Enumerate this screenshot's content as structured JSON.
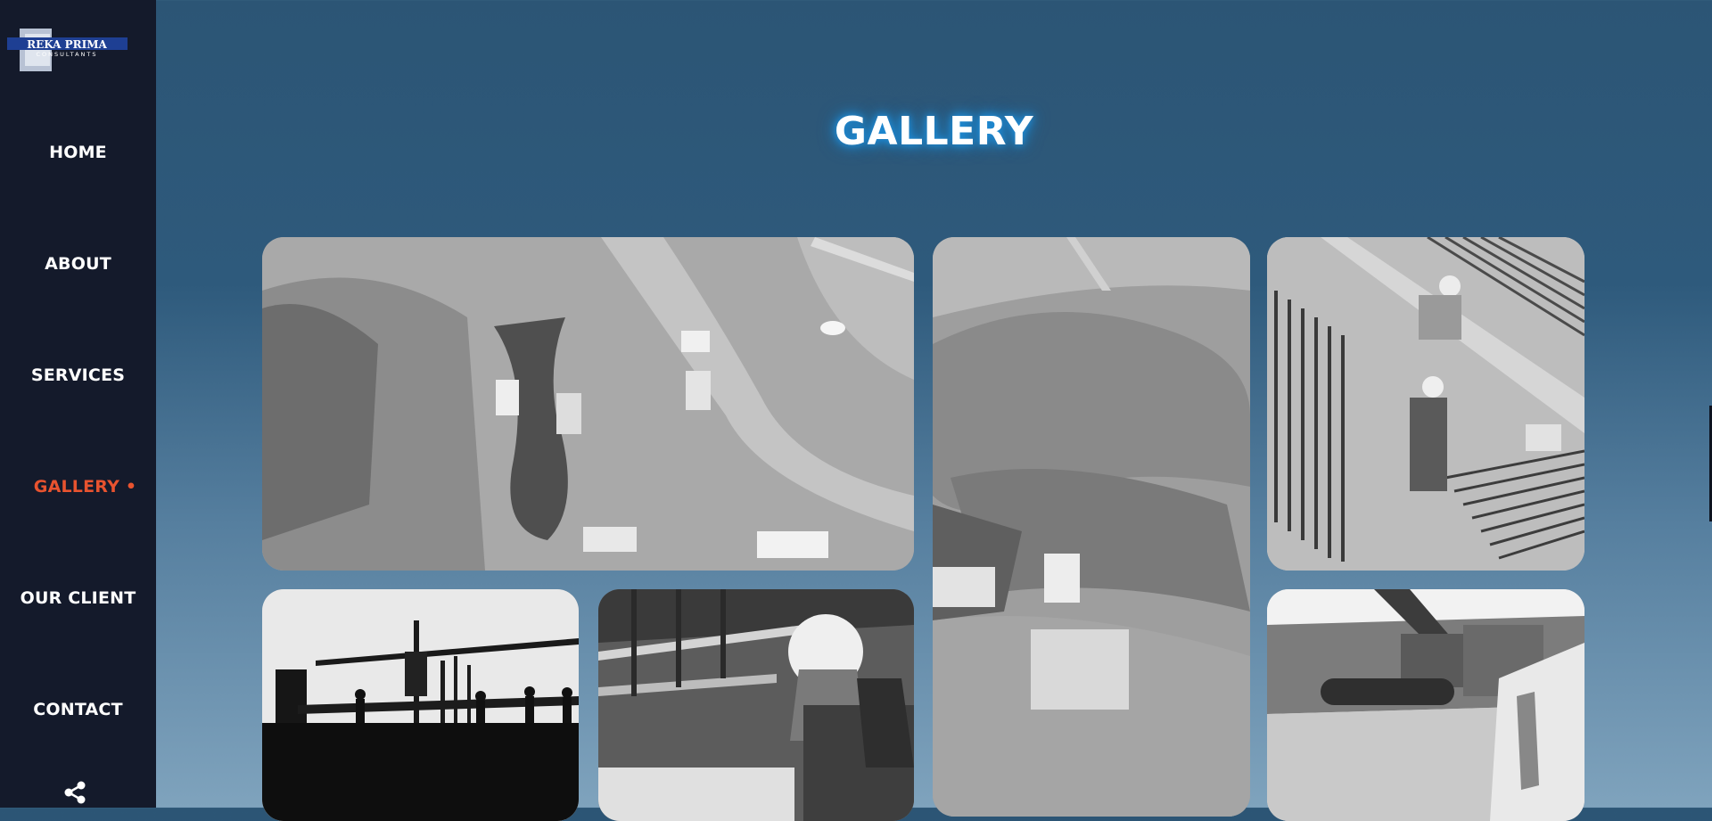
{
  "brand": {
    "logo_line1": "REKA PRIMA",
    "logo_line2": "CONSULTANTS"
  },
  "nav": {
    "items": [
      {
        "label": "HOME"
      },
      {
        "label": "ABOUT"
      },
      {
        "label": "SERVICES"
      },
      {
        "label": "GALLERY •"
      },
      {
        "label": "OUR CLIENT"
      },
      {
        "label": "CONTACT"
      }
    ],
    "active": "GALLERY"
  },
  "page": {
    "title": "GALLERY"
  },
  "gallery": {
    "images": [
      {
        "subject": "aerial-construction-site"
      },
      {
        "subject": "aerial-earthworks"
      },
      {
        "subject": "workers-rebar"
      },
      {
        "subject": "crane-silhouette"
      },
      {
        "subject": "worker-helmet"
      },
      {
        "subject": "excavators"
      }
    ]
  },
  "colors": {
    "sidebar": "#141a2b",
    "active_nav": "#e8532f",
    "title_glow": "#1d8bd6"
  }
}
